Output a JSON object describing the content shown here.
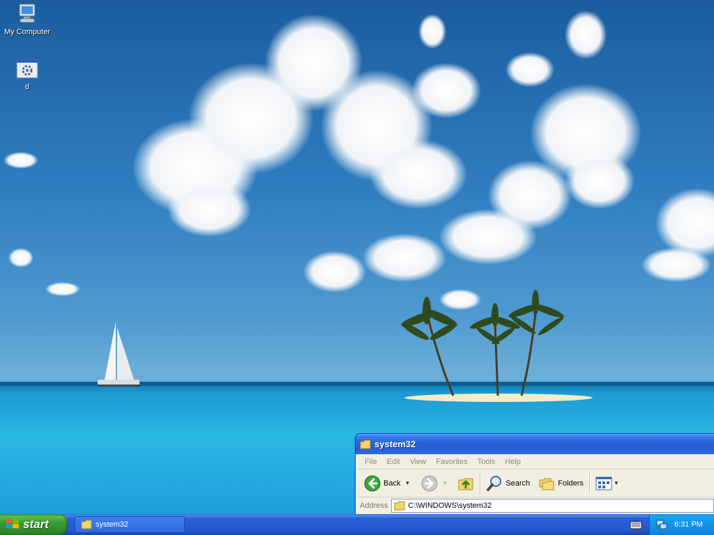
{
  "desktop": {
    "icons": [
      {
        "label": "My Computer",
        "icon": "my-computer-icon"
      },
      {
        "label": "d",
        "icon": "application-icon"
      }
    ]
  },
  "window": {
    "title": "system32",
    "menu": [
      "File",
      "Edit",
      "View",
      "Favorites",
      "Tools",
      "Help"
    ],
    "toolbar": {
      "back_label": "Back",
      "search_label": "Search",
      "folders_label": "Folders"
    },
    "address": {
      "label": "Address",
      "path": "C:\\WINDOWS\\system32"
    }
  },
  "taskbar": {
    "start_label": "start",
    "items": [
      {
        "label": "system32",
        "icon": "folder-icon"
      }
    ],
    "clock": "6:31 PM"
  },
  "colors": {
    "titlebar": "#245ed5",
    "taskbar": "#2357cf",
    "start_button": "#3a9b34",
    "tray": "#1493e6"
  }
}
